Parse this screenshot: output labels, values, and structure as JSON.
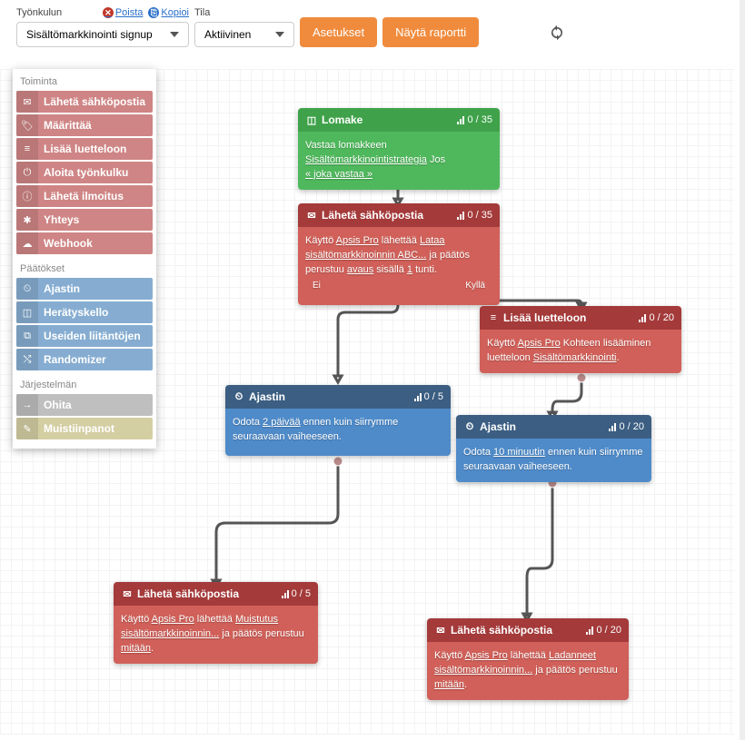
{
  "toolbar": {
    "workflow_label": "Työnkulun",
    "state_label": "Tila",
    "delete_label": "Poista",
    "copy_label": "Kopioi",
    "workflow_value": "Sisältömarkkinointi signup",
    "state_value": "Aktiivinen",
    "settings_btn": "Asetukset",
    "report_btn": "Näytä raportti"
  },
  "sidebar": {
    "sections": {
      "actions": "Toiminta",
      "decisions": "Päätökset",
      "system": "Järjestelmän"
    },
    "actions": [
      {
        "icon": "✉",
        "label": "Lähetä sähköpostia"
      },
      {
        "icon": "🏷",
        "label": "Määrittää"
      },
      {
        "icon": "≡",
        "label": "Lisää luetteloon"
      },
      {
        "icon": "⏻",
        "label": "Aloita työnkulku"
      },
      {
        "icon": "ⓘ",
        "label": "Lähetä ilmoitus"
      },
      {
        "icon": "✱",
        "label": "Yhteys"
      },
      {
        "icon": "☁",
        "label": "Webhook"
      }
    ],
    "decisions": [
      {
        "icon": "⏲",
        "label": "Ajastin"
      },
      {
        "icon": "◫",
        "label": "Herätyskello"
      },
      {
        "icon": "⧉",
        "label": "Useiden liitäntöjen"
      },
      {
        "icon": "⤭",
        "label": "Randomizer"
      }
    ],
    "system": [
      {
        "icon": "→",
        "label": "Ohita"
      },
      {
        "icon": "✎",
        "label": "Muistiinpanot"
      }
    ]
  },
  "nodes": {
    "form": {
      "title": "Lomake",
      "stat": "0 / 35",
      "body_1": "Vastaa lomakkeen ",
      "body_link": "Sisältömarkkinointistrategia",
      "body_2": " Jos ",
      "body_link2": "« joka vastaa »"
    },
    "email1": {
      "title": "Lähetä sähköpostia",
      "stat": "0 / 35",
      "b1": "Käyttö ",
      "l1": "Apsis Pro",
      "b2": " lähettää ",
      "l2": "Lataa sisältömarkkinoinnin ABC...",
      "b3": " ja päätös perustuu ",
      "l3": "avaus",
      "b4": " sisällä ",
      "l4": "1",
      "b5": " tunti.",
      "left": "Ei",
      "right": "Kyllä"
    },
    "addlist": {
      "title": "Lisää luetteloon",
      "stat": "0 / 20",
      "b1": "Käyttö ",
      "l1": "Apsis Pro",
      "b2": " Kohteen lisääminen luetteloon ",
      "l2": "Sisältömarkkinointi",
      "b3": "."
    },
    "timer1": {
      "title": "Ajastin",
      "stat": "0 / 5",
      "b1": "Odota ",
      "l1": "2 päivää",
      "b2": " ennen kuin siirrymme seuraavaan vaiheeseen."
    },
    "timer2": {
      "title": "Ajastin",
      "stat": "0 / 20",
      "b1": "Odota ",
      "l1": "10 minuutin",
      "b2": " ennen kuin siirrymme seuraavaan vaiheeseen."
    },
    "email2": {
      "title": "Lähetä sähköpostia",
      "stat": "0 / 5",
      "b1": "Käyttö ",
      "l1": "Apsis Pro",
      "b2": " lähettää ",
      "l2": "Muistutus sisältömarkkinoinnin...",
      "b3": " ja päätös perustuu ",
      "l3": "mitään",
      "b4": "."
    },
    "email3": {
      "title": "Lähetä sähköpostia",
      "stat": "0 / 20",
      "b1": "Käyttö ",
      "l1": "Apsis Pro",
      "b2": " lähettää ",
      "l2": "Ladanneet sisältömarkkinoinnin...",
      "b3": " ja päätös perustuu ",
      "l3": "mitään",
      "b4": "."
    }
  }
}
